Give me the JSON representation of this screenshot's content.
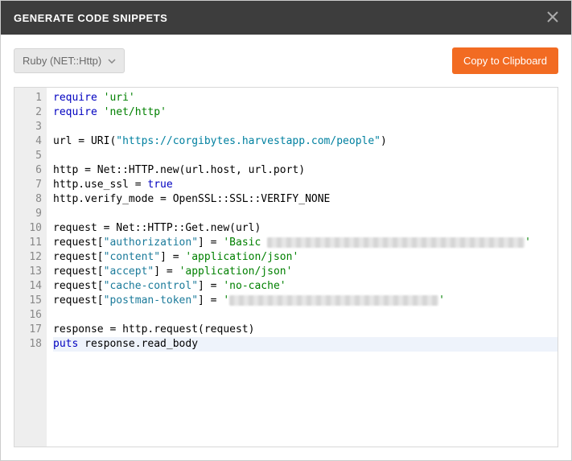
{
  "header": {
    "title": "GENERATE CODE SNIPPETS"
  },
  "toolbar": {
    "dropdown_label": "Ruby (NET::Http)",
    "copy_label": "Copy to Clipboard"
  },
  "code": {
    "lines": [
      {
        "n": 1,
        "segs": [
          {
            "t": "require ",
            "c": "kw"
          },
          {
            "t": "'uri'",
            "c": "str"
          }
        ]
      },
      {
        "n": 2,
        "segs": [
          {
            "t": "require ",
            "c": "kw"
          },
          {
            "t": "'net/http'",
            "c": "str"
          }
        ]
      },
      {
        "n": 3,
        "segs": []
      },
      {
        "n": 4,
        "segs": [
          {
            "t": "url = URI(",
            "c": "id"
          },
          {
            "t": "\"https://corgibytes.harvestapp.com/people\"",
            "c": "str2"
          },
          {
            "t": ")",
            "c": "id"
          }
        ]
      },
      {
        "n": 5,
        "segs": []
      },
      {
        "n": 6,
        "segs": [
          {
            "t": "http = Net::HTTP.new(url.host, url.port)",
            "c": "id"
          }
        ]
      },
      {
        "n": 7,
        "segs": [
          {
            "t": "http.use_ssl = ",
            "c": "id"
          },
          {
            "t": "true",
            "c": "kw"
          }
        ]
      },
      {
        "n": 8,
        "segs": [
          {
            "t": "http.verify_mode = OpenSSL::SSL::VERIFY_NONE",
            "c": "id"
          }
        ]
      },
      {
        "n": 9,
        "segs": []
      },
      {
        "n": 10,
        "segs": [
          {
            "t": "request = Net::HTTP::Get.new(url)",
            "c": "id"
          }
        ]
      },
      {
        "n": 11,
        "segs": [
          {
            "t": "request[",
            "c": "id"
          },
          {
            "t": "\"authorization\"",
            "c": "header"
          },
          {
            "t": "] = ",
            "c": "id"
          },
          {
            "t": "'Basic ",
            "c": "str"
          },
          {
            "redact": 320
          },
          {
            "t": "'",
            "c": "str"
          }
        ]
      },
      {
        "n": 12,
        "segs": [
          {
            "t": "request[",
            "c": "id"
          },
          {
            "t": "\"content\"",
            "c": "header"
          },
          {
            "t": "] = ",
            "c": "id"
          },
          {
            "t": "'application/json'",
            "c": "str"
          }
        ]
      },
      {
        "n": 13,
        "segs": [
          {
            "t": "request[",
            "c": "id"
          },
          {
            "t": "\"accept\"",
            "c": "header"
          },
          {
            "t": "] = ",
            "c": "id"
          },
          {
            "t": "'application/json'",
            "c": "str"
          }
        ]
      },
      {
        "n": 14,
        "segs": [
          {
            "t": "request[",
            "c": "id"
          },
          {
            "t": "\"cache-control\"",
            "c": "header"
          },
          {
            "t": "] = ",
            "c": "id"
          },
          {
            "t": "'no-cache'",
            "c": "str"
          }
        ]
      },
      {
        "n": 15,
        "segs": [
          {
            "t": "request[",
            "c": "id"
          },
          {
            "t": "\"postman-token\"",
            "c": "header"
          },
          {
            "t": "] = ",
            "c": "id"
          },
          {
            "t": "'",
            "c": "str"
          },
          {
            "redact": 260
          },
          {
            "t": "'",
            "c": "str"
          }
        ]
      },
      {
        "n": 16,
        "segs": []
      },
      {
        "n": 17,
        "segs": [
          {
            "t": "response = http.request(request)",
            "c": "id"
          }
        ]
      },
      {
        "n": 18,
        "hl": true,
        "segs": [
          {
            "t": "puts",
            "c": "kw"
          },
          {
            "t": " response.read_body",
            "c": "id"
          }
        ]
      }
    ]
  }
}
